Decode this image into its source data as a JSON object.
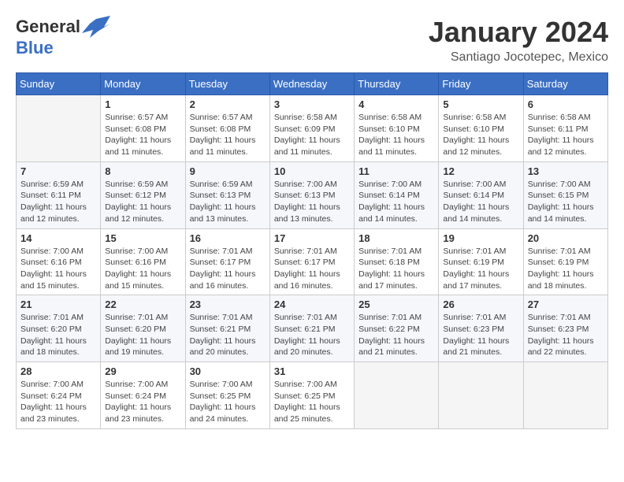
{
  "header": {
    "logo": {
      "general": "General",
      "blue": "Blue"
    },
    "title": "January 2024",
    "location": "Santiago Jocotepec, Mexico"
  },
  "calendar": {
    "weekdays": [
      "Sunday",
      "Monday",
      "Tuesday",
      "Wednesday",
      "Thursday",
      "Friday",
      "Saturday"
    ],
    "weeks": [
      [
        {
          "day": "",
          "sunrise": "",
          "sunset": "",
          "daylight": ""
        },
        {
          "day": "1",
          "sunrise": "Sunrise: 6:57 AM",
          "sunset": "Sunset: 6:08 PM",
          "daylight": "Daylight: 11 hours and 11 minutes."
        },
        {
          "day": "2",
          "sunrise": "Sunrise: 6:57 AM",
          "sunset": "Sunset: 6:08 PM",
          "daylight": "Daylight: 11 hours and 11 minutes."
        },
        {
          "day": "3",
          "sunrise": "Sunrise: 6:58 AM",
          "sunset": "Sunset: 6:09 PM",
          "daylight": "Daylight: 11 hours and 11 minutes."
        },
        {
          "day": "4",
          "sunrise": "Sunrise: 6:58 AM",
          "sunset": "Sunset: 6:10 PM",
          "daylight": "Daylight: 11 hours and 11 minutes."
        },
        {
          "day": "5",
          "sunrise": "Sunrise: 6:58 AM",
          "sunset": "Sunset: 6:10 PM",
          "daylight": "Daylight: 11 hours and 12 minutes."
        },
        {
          "day": "6",
          "sunrise": "Sunrise: 6:58 AM",
          "sunset": "Sunset: 6:11 PM",
          "daylight": "Daylight: 11 hours and 12 minutes."
        }
      ],
      [
        {
          "day": "7",
          "sunrise": "Sunrise: 6:59 AM",
          "sunset": "Sunset: 6:11 PM",
          "daylight": "Daylight: 11 hours and 12 minutes."
        },
        {
          "day": "8",
          "sunrise": "Sunrise: 6:59 AM",
          "sunset": "Sunset: 6:12 PM",
          "daylight": "Daylight: 11 hours and 12 minutes."
        },
        {
          "day": "9",
          "sunrise": "Sunrise: 6:59 AM",
          "sunset": "Sunset: 6:13 PM",
          "daylight": "Daylight: 11 hours and 13 minutes."
        },
        {
          "day": "10",
          "sunrise": "Sunrise: 7:00 AM",
          "sunset": "Sunset: 6:13 PM",
          "daylight": "Daylight: 11 hours and 13 minutes."
        },
        {
          "day": "11",
          "sunrise": "Sunrise: 7:00 AM",
          "sunset": "Sunset: 6:14 PM",
          "daylight": "Daylight: 11 hours and 14 minutes."
        },
        {
          "day": "12",
          "sunrise": "Sunrise: 7:00 AM",
          "sunset": "Sunset: 6:14 PM",
          "daylight": "Daylight: 11 hours and 14 minutes."
        },
        {
          "day": "13",
          "sunrise": "Sunrise: 7:00 AM",
          "sunset": "Sunset: 6:15 PM",
          "daylight": "Daylight: 11 hours and 14 minutes."
        }
      ],
      [
        {
          "day": "14",
          "sunrise": "Sunrise: 7:00 AM",
          "sunset": "Sunset: 6:16 PM",
          "daylight": "Daylight: 11 hours and 15 minutes."
        },
        {
          "day": "15",
          "sunrise": "Sunrise: 7:00 AM",
          "sunset": "Sunset: 6:16 PM",
          "daylight": "Daylight: 11 hours and 15 minutes."
        },
        {
          "day": "16",
          "sunrise": "Sunrise: 7:01 AM",
          "sunset": "Sunset: 6:17 PM",
          "daylight": "Daylight: 11 hours and 16 minutes."
        },
        {
          "day": "17",
          "sunrise": "Sunrise: 7:01 AM",
          "sunset": "Sunset: 6:17 PM",
          "daylight": "Daylight: 11 hours and 16 minutes."
        },
        {
          "day": "18",
          "sunrise": "Sunrise: 7:01 AM",
          "sunset": "Sunset: 6:18 PM",
          "daylight": "Daylight: 11 hours and 17 minutes."
        },
        {
          "day": "19",
          "sunrise": "Sunrise: 7:01 AM",
          "sunset": "Sunset: 6:19 PM",
          "daylight": "Daylight: 11 hours and 17 minutes."
        },
        {
          "day": "20",
          "sunrise": "Sunrise: 7:01 AM",
          "sunset": "Sunset: 6:19 PM",
          "daylight": "Daylight: 11 hours and 18 minutes."
        }
      ],
      [
        {
          "day": "21",
          "sunrise": "Sunrise: 7:01 AM",
          "sunset": "Sunset: 6:20 PM",
          "daylight": "Daylight: 11 hours and 18 minutes."
        },
        {
          "day": "22",
          "sunrise": "Sunrise: 7:01 AM",
          "sunset": "Sunset: 6:20 PM",
          "daylight": "Daylight: 11 hours and 19 minutes."
        },
        {
          "day": "23",
          "sunrise": "Sunrise: 7:01 AM",
          "sunset": "Sunset: 6:21 PM",
          "daylight": "Daylight: 11 hours and 20 minutes."
        },
        {
          "day": "24",
          "sunrise": "Sunrise: 7:01 AM",
          "sunset": "Sunset: 6:21 PM",
          "daylight": "Daylight: 11 hours and 20 minutes."
        },
        {
          "day": "25",
          "sunrise": "Sunrise: 7:01 AM",
          "sunset": "Sunset: 6:22 PM",
          "daylight": "Daylight: 11 hours and 21 minutes."
        },
        {
          "day": "26",
          "sunrise": "Sunrise: 7:01 AM",
          "sunset": "Sunset: 6:23 PM",
          "daylight": "Daylight: 11 hours and 21 minutes."
        },
        {
          "day": "27",
          "sunrise": "Sunrise: 7:01 AM",
          "sunset": "Sunset: 6:23 PM",
          "daylight": "Daylight: 11 hours and 22 minutes."
        }
      ],
      [
        {
          "day": "28",
          "sunrise": "Sunrise: 7:00 AM",
          "sunset": "Sunset: 6:24 PM",
          "daylight": "Daylight: 11 hours and 23 minutes."
        },
        {
          "day": "29",
          "sunrise": "Sunrise: 7:00 AM",
          "sunset": "Sunset: 6:24 PM",
          "daylight": "Daylight: 11 hours and 23 minutes."
        },
        {
          "day": "30",
          "sunrise": "Sunrise: 7:00 AM",
          "sunset": "Sunset: 6:25 PM",
          "daylight": "Daylight: 11 hours and 24 minutes."
        },
        {
          "day": "31",
          "sunrise": "Sunrise: 7:00 AM",
          "sunset": "Sunset: 6:25 PM",
          "daylight": "Daylight: 11 hours and 25 minutes."
        },
        {
          "day": "",
          "sunrise": "",
          "sunset": "",
          "daylight": ""
        },
        {
          "day": "",
          "sunrise": "",
          "sunset": "",
          "daylight": ""
        },
        {
          "day": "",
          "sunrise": "",
          "sunset": "",
          "daylight": ""
        }
      ]
    ]
  }
}
